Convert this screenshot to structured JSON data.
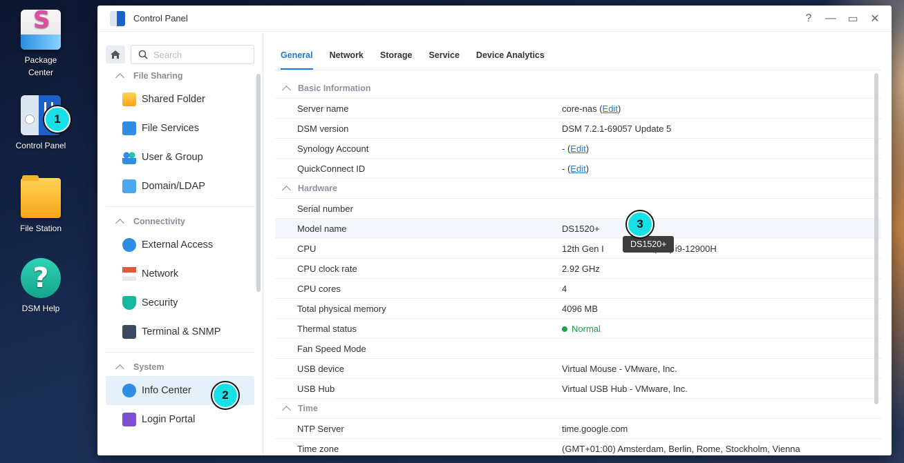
{
  "desktop": {
    "icons": [
      {
        "label_line1": "Package",
        "label_line2": "Center"
      },
      {
        "label": "Control Panel"
      },
      {
        "label": "File Station"
      },
      {
        "label": "DSM Help"
      }
    ]
  },
  "badges": [
    "1",
    "2",
    "3"
  ],
  "window": {
    "title": "Control Panel",
    "controls": {
      "help": "?",
      "minimize": "—",
      "maximize": "▭",
      "close": "✕"
    }
  },
  "sidebar": {
    "search_placeholder": "Search",
    "sections": [
      {
        "title": "File Sharing",
        "items": [
          "Shared Folder",
          "File Services",
          "User & Group",
          "Domain/LDAP"
        ]
      },
      {
        "title": "Connectivity",
        "items": [
          "External Access",
          "Network",
          "Security",
          "Terminal & SNMP"
        ]
      },
      {
        "title": "System",
        "items": [
          "Info Center",
          "Login Portal"
        ]
      }
    ],
    "active_item": "Info Center"
  },
  "tabs": [
    "General",
    "Network",
    "Storage",
    "Service",
    "Device Analytics"
  ],
  "active_tab": "General",
  "info": {
    "basic_title": "Basic Information",
    "server_name_label": "Server name",
    "server_name_value": "core-nas",
    "dsm_version_label": "DSM version",
    "dsm_version_value": "DSM 7.2.1-69057 Update 5",
    "synology_account_label": "Synology Account",
    "synology_account_value": "-",
    "quickconnect_label": "QuickConnect ID",
    "quickconnect_value": "-",
    "edit_label": "Edit",
    "hardware_title": "Hardware",
    "serial_label": "Serial number",
    "model_label": "Model name",
    "model_value": "DS1520+",
    "cpu_label": "CPU",
    "cpu_value_start": "12th Gen I",
    "cpu_value_end": "(TM) i9-12900H",
    "cpu_clock_label": "CPU clock rate",
    "cpu_clock_value": "2.92 GHz",
    "cpu_cores_label": "CPU cores",
    "cpu_cores_value": "4",
    "memory_label": "Total physical memory",
    "memory_value": "4096 MB",
    "thermal_label": "Thermal status",
    "thermal_value": "Normal",
    "fan_label": "Fan Speed Mode",
    "usb_device_label": "USB device",
    "usb_device_value": "Virtual Mouse - VMware, Inc.",
    "usb_hub_label": "USB Hub",
    "usb_hub_value": "Virtual USB Hub - VMware, Inc.",
    "time_title": "Time",
    "ntp_label": "NTP Server",
    "ntp_value": "time.google.com",
    "timezone_label": "Time zone",
    "timezone_value": "(GMT+01:00) Amsterdam, Berlin, Rome, Stockholm, Vienna"
  },
  "tooltip": "DS1520+",
  "colors": {
    "accent": "#1d7bd1",
    "status_ok": "#1aa349",
    "badge": "#17e0e6"
  }
}
